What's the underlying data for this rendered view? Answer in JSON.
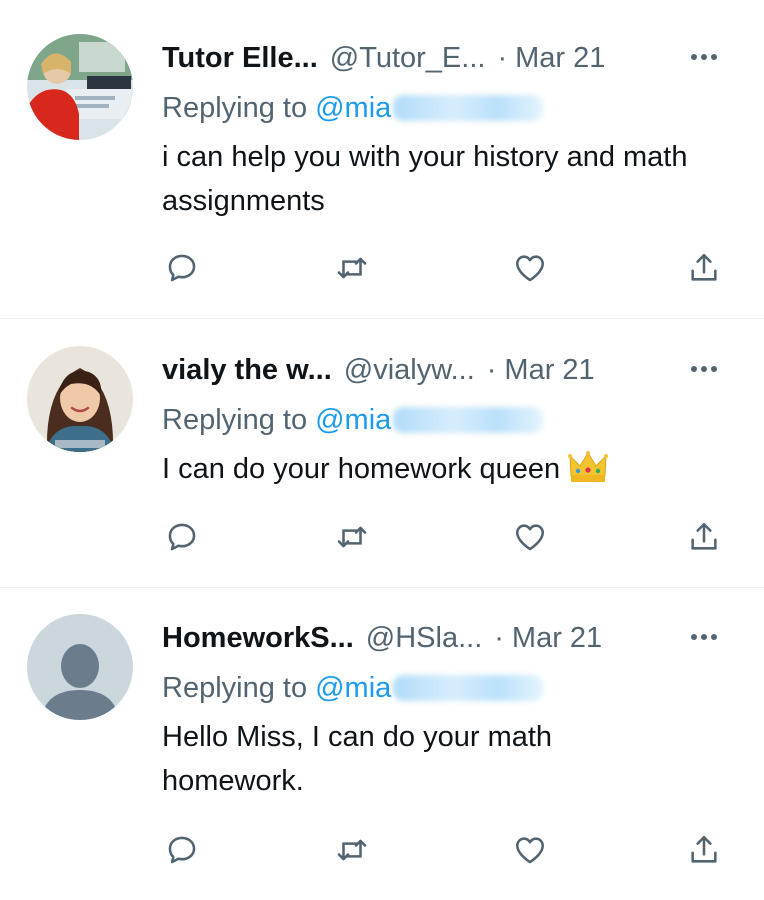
{
  "replies": [
    {
      "display_name": "Tutor Elle...",
      "handle": "@Tutor_E...",
      "separator": "·",
      "date": "Mar 21",
      "replying_label": "Replying to",
      "mention": "@mia",
      "text": "i can help you with your history and math assignments",
      "avatar": "photo-avatar-classroom",
      "has_crown": false
    },
    {
      "display_name": "vialy the w...",
      "handle": "@vialyw...",
      "separator": "·",
      "date": "Mar 21",
      "replying_label": "Replying to",
      "mention": "@mia",
      "text": "I can do your homework queen",
      "avatar": "photo-avatar-woman",
      "has_crown": true
    },
    {
      "display_name": "HomeworkS...",
      "handle": "@HSla...",
      "separator": "·",
      "date": "Mar 21",
      "replying_label": "Replying to",
      "mention": "@mia",
      "text": "Hello Miss, I can do your math homework.",
      "avatar": "default-avatar",
      "has_crown": false
    }
  ],
  "icons": {
    "more": "more-horizontal-icon",
    "reply": "reply-bubble-icon",
    "retweet": "retweet-icon",
    "like": "heart-icon",
    "share": "share-upload-icon",
    "crown": "crown-emoji-icon"
  },
  "colors": {
    "text_primary": "#0f1419",
    "text_secondary": "#536471",
    "accent_blue": "#1d9bf0",
    "divider": "#eff3f4",
    "crown_gold": "#f4c430"
  }
}
